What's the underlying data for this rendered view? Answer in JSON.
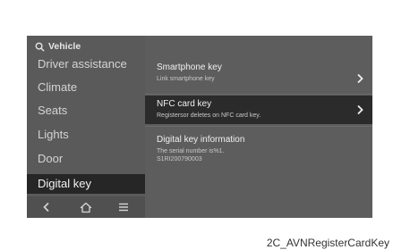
{
  "screen": {
    "search_label": "Vehicle",
    "sidebar": {
      "items": [
        {
          "label": "Driver assistance",
          "active": false
        },
        {
          "label": "Climate",
          "active": false
        },
        {
          "label": "Seats",
          "active": false
        },
        {
          "label": "Lights",
          "active": false
        },
        {
          "label": "Door",
          "active": false
        },
        {
          "label": "Digital key",
          "active": true
        }
      ]
    },
    "nav_icons": [
      "back-icon",
      "home-icon",
      "menu-icon"
    ],
    "panel": {
      "rows": [
        {
          "title": "Smartphone key",
          "subtitle": "Link smartphone key",
          "has_chevron": true,
          "highlighted": false
        },
        {
          "title": "NFC card key",
          "subtitle": "Registersor deletes on NFC card key.",
          "has_chevron": true,
          "highlighted": true
        },
        {
          "title": "Digital key information",
          "subtitle_lines": [
            "The serial number is%1.",
            "S1RI200790003"
          ],
          "has_chevron": false,
          "highlighted": false
        }
      ]
    }
  },
  "caption": "2C_AVNRegisterCardKey",
  "colors": {
    "screen_bg": "#5d5d5d",
    "active_item_bg": "#262626",
    "highlight_row_bg": "#2b2b2b",
    "text_primary": "#f0f0f0",
    "text_secondary": "#c8c8c8"
  }
}
